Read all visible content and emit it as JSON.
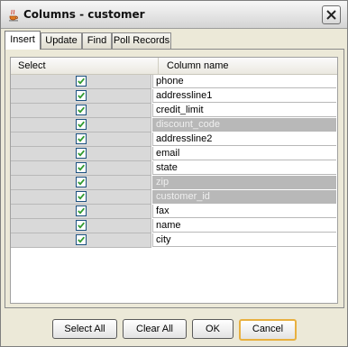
{
  "window": {
    "title": "Columns - customer",
    "icon": "java-icon"
  },
  "tabs": [
    {
      "label": "Insert",
      "active": true
    },
    {
      "label": "Update",
      "active": false
    },
    {
      "label": "Find",
      "active": false
    },
    {
      "label": "Poll Records",
      "active": false
    }
  ],
  "table": {
    "headers": {
      "select": "Select",
      "column_name": "Column name"
    },
    "rows": [
      {
        "name": "phone",
        "checked": true,
        "disabled": false
      },
      {
        "name": "addressline1",
        "checked": true,
        "disabled": false
      },
      {
        "name": "credit_limit",
        "checked": true,
        "disabled": false
      },
      {
        "name": "discount_code",
        "checked": true,
        "disabled": true
      },
      {
        "name": "addressline2",
        "checked": true,
        "disabled": false
      },
      {
        "name": "email",
        "checked": true,
        "disabled": false
      },
      {
        "name": "state",
        "checked": true,
        "disabled": false
      },
      {
        "name": "zip",
        "checked": true,
        "disabled": true
      },
      {
        "name": "customer_id",
        "checked": true,
        "disabled": true
      },
      {
        "name": "fax",
        "checked": true,
        "disabled": false
      },
      {
        "name": "name",
        "checked": true,
        "disabled": false
      },
      {
        "name": "city",
        "checked": true,
        "disabled": false
      }
    ]
  },
  "buttons": {
    "select_all": "Select All",
    "clear_all": "Clear All",
    "ok": "OK",
    "cancel": "Cancel"
  },
  "colors": {
    "check": "#2f9a2f",
    "disabled_row": "#b8b8b8",
    "default_button_border": "#e8b040"
  }
}
